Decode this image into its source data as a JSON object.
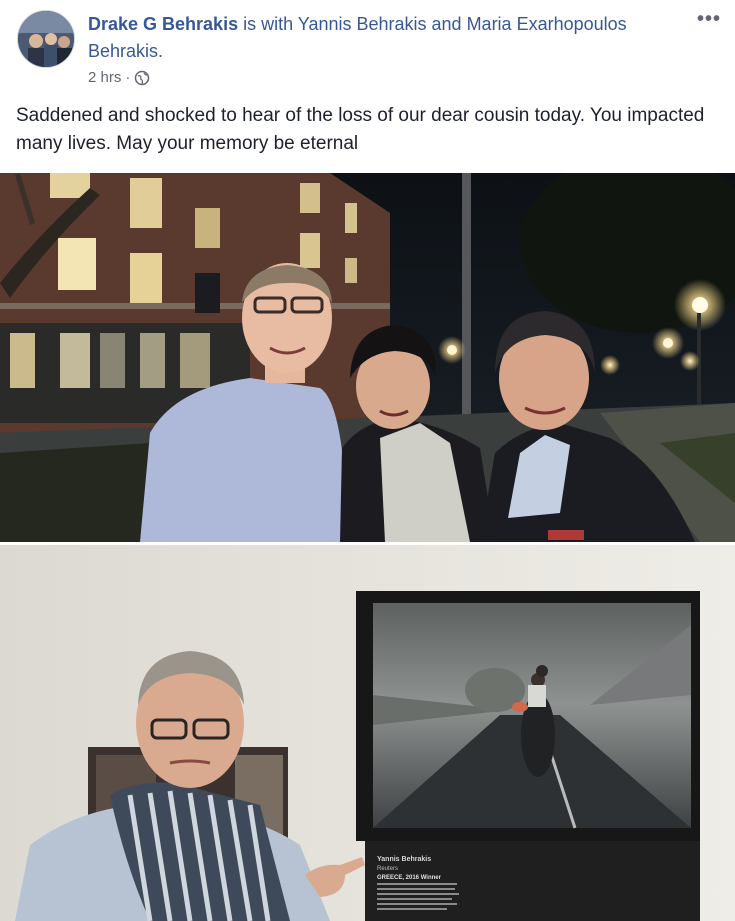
{
  "post": {
    "author": "Drake G Behrakis",
    "with_text": " is with ",
    "tagged_1": "Yannis Behrakis",
    "and_text": " and ",
    "tagged_2": "Maria Exarhopoulos Behrakis",
    "period": ".",
    "time": "2 hrs",
    "separator": "·",
    "privacy_icon": "globe-icon",
    "more_icon": "ellipsis-icon",
    "more_label": "•••",
    "text": "Saddened and shocked to hear of the loss of our dear cousin today. You impacted many lives. May your memory be eternal"
  },
  "photos": [
    {
      "description_icon": "photo-group-night"
    },
    {
      "exhibit_caption": {
        "title": "Yannis Behrakis",
        "subtitle": "Reuters",
        "line3": "GREECE, 2016 Winner"
      }
    }
  ],
  "colors": {
    "link": "#365899",
    "meta": "#616770",
    "text": "#1d2129"
  }
}
